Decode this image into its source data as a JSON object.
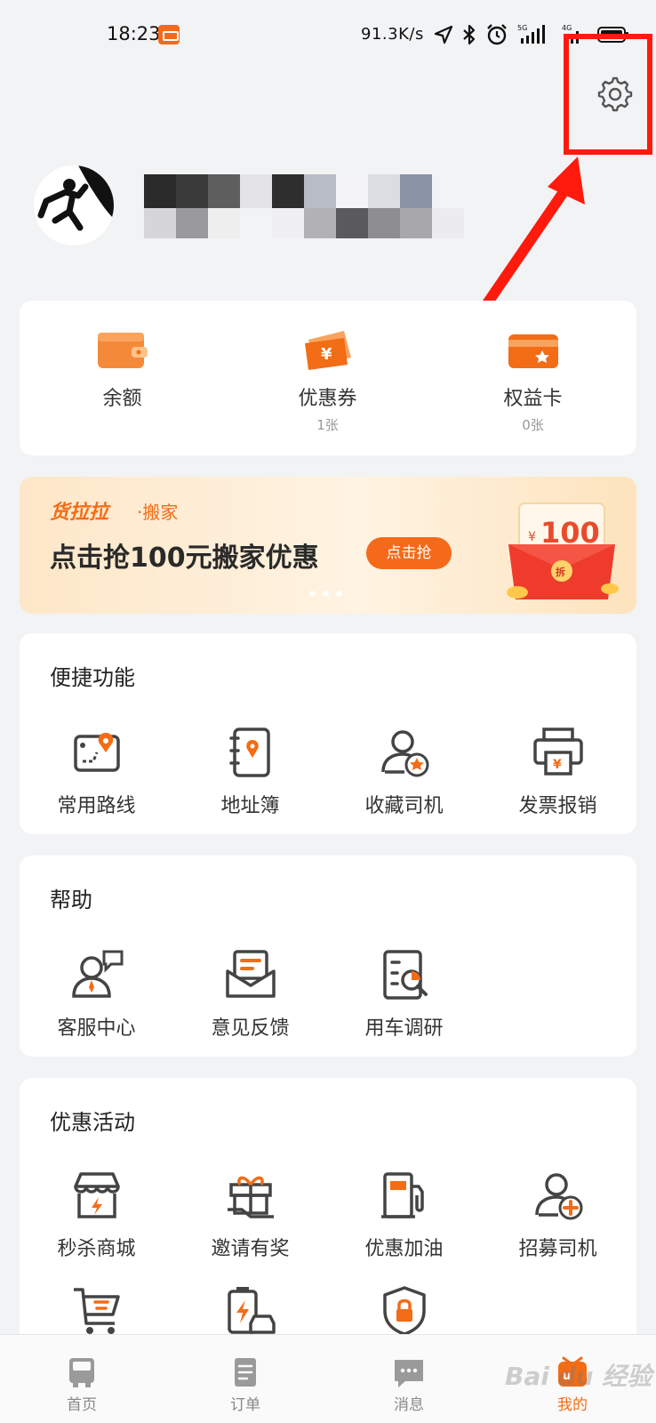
{
  "status_bar": {
    "time": "18:23",
    "network_speed": "91.3K/s",
    "icons": [
      "navigation-icon",
      "bluetooth-icon",
      "alarm-icon",
      "signal-5g-icon",
      "signal-4g-icon",
      "battery-icon"
    ]
  },
  "header": {
    "settings_icon": "gear-icon"
  },
  "profile": {
    "avatar": "climber-avatar"
  },
  "wallet": {
    "items": [
      {
        "label": "余额",
        "sub": "",
        "icon": "wallet-icon"
      },
      {
        "label": "优惠券",
        "sub": "1张",
        "icon": "coupon-icon"
      },
      {
        "label": "权益卡",
        "sub": "0张",
        "icon": "benefit-card-icon"
      }
    ]
  },
  "banner": {
    "brand": "货拉拉",
    "sub": "·搬家",
    "title": "点击抢100元搬家优惠",
    "button": "点击抢",
    "amount_symbol": "¥",
    "amount": "100",
    "packet_text": "拆"
  },
  "shortcuts": {
    "title": "便捷功能",
    "items": [
      {
        "label": "常用路线",
        "icon": "route-map-icon"
      },
      {
        "label": "地址簿",
        "icon": "address-book-icon"
      },
      {
        "label": "收藏司机",
        "icon": "favorite-driver-icon"
      },
      {
        "label": "发票报销",
        "icon": "invoice-printer-icon"
      }
    ]
  },
  "help": {
    "title": "帮助",
    "items": [
      {
        "label": "客服中心",
        "icon": "customer-service-icon"
      },
      {
        "label": "意见反馈",
        "icon": "feedback-mail-icon"
      },
      {
        "label": "用车调研",
        "icon": "survey-icon"
      }
    ]
  },
  "promotions": {
    "title": "优惠活动",
    "items": [
      {
        "label": "秒杀商城",
        "icon": "flash-shop-icon"
      },
      {
        "label": "邀请有奖",
        "icon": "gift-icon"
      },
      {
        "label": "优惠加油",
        "icon": "fuel-pump-icon"
      },
      {
        "label": "招募司机",
        "icon": "recruit-driver-icon"
      },
      {
        "label": "",
        "icon": "shopping-cart-icon"
      },
      {
        "label": "",
        "icon": "battery-car-icon"
      },
      {
        "label": "",
        "icon": "security-shield-icon"
      }
    ]
  },
  "bottom_nav": {
    "items": [
      {
        "label": "首页",
        "icon": "truck-home-icon"
      },
      {
        "label": "订单",
        "icon": "order-list-icon"
      },
      {
        "label": "消息",
        "icon": "message-icon"
      },
      {
        "label": "我的",
        "icon": "profile-brand-icon"
      }
    ],
    "active_index": 3
  },
  "watermark": "Bai du 经验",
  "colors": {
    "accent": "#f36c16",
    "annotation_red": "#ff1a0d",
    "background": "#f2f3f5",
    "icon_gray": "#444444"
  }
}
